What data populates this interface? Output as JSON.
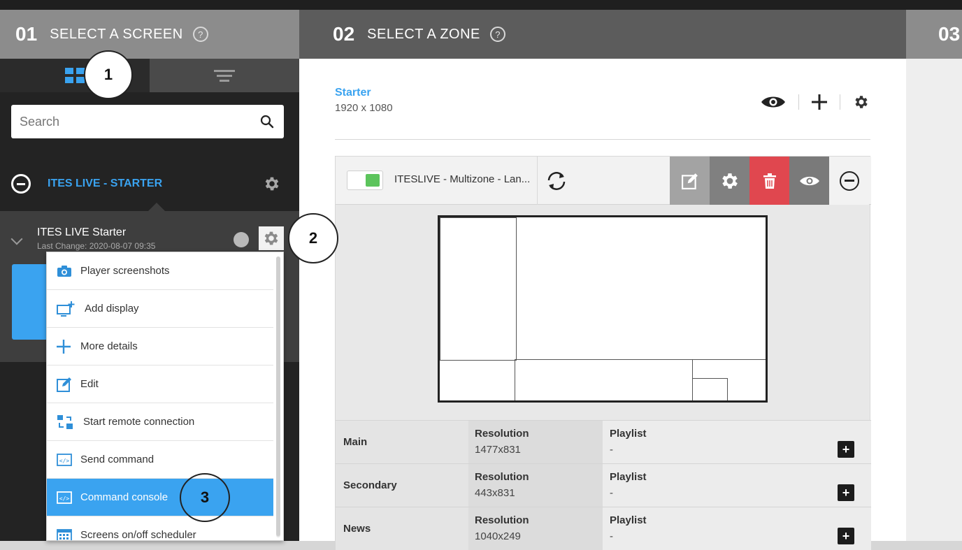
{
  "steps": [
    {
      "num": "01",
      "title": "SELECT A SCREEN"
    },
    {
      "num": "02",
      "title": "SELECT A ZONE"
    },
    {
      "num": "03"
    }
  ],
  "search": {
    "placeholder": "Search",
    "icon": "search-icon"
  },
  "group": {
    "title": "ITES LIVE - STARTER"
  },
  "screen": {
    "name": "ITES LIVE Starter",
    "last_change": "Last Change: 2020-08-07 09:35"
  },
  "menu": {
    "items": [
      {
        "label": "Player screenshots",
        "icon": "camera-icon"
      },
      {
        "label": "Add display",
        "icon": "add-display-icon"
      },
      {
        "label": "More details",
        "icon": "plus-icon"
      },
      {
        "label": "Edit",
        "icon": "edit-icon"
      },
      {
        "label": "Start remote connection",
        "icon": "remote-connection-icon"
      },
      {
        "label": "Send command",
        "icon": "code-icon"
      },
      {
        "label": "Command console",
        "icon": "code-icon",
        "active": true
      },
      {
        "label": "Screens on/off scheduler",
        "icon": "calendar-icon"
      }
    ]
  },
  "callouts": [
    "1",
    "2",
    "3"
  ],
  "layout": {
    "name": "Starter",
    "resolution": "1920 x 1080"
  },
  "zone_bar": {
    "title": "ITESLIVE - Multizone - Lan..."
  },
  "zones": [
    {
      "name": "Main",
      "res_label": "Resolution",
      "res": "1477x831",
      "pl_label": "Playlist",
      "pl": "-"
    },
    {
      "name": "Secondary",
      "res_label": "Resolution",
      "res": "443x831",
      "pl_label": "Playlist",
      "pl": "-"
    },
    {
      "name": "News",
      "res_label": "Resolution",
      "res": "1040x249",
      "pl_label": "Playlist",
      "pl": "-"
    }
  ],
  "colors": {
    "accent": "#3aa3f0",
    "danger": "#e0474f",
    "active_toggle": "#5cc45c"
  }
}
